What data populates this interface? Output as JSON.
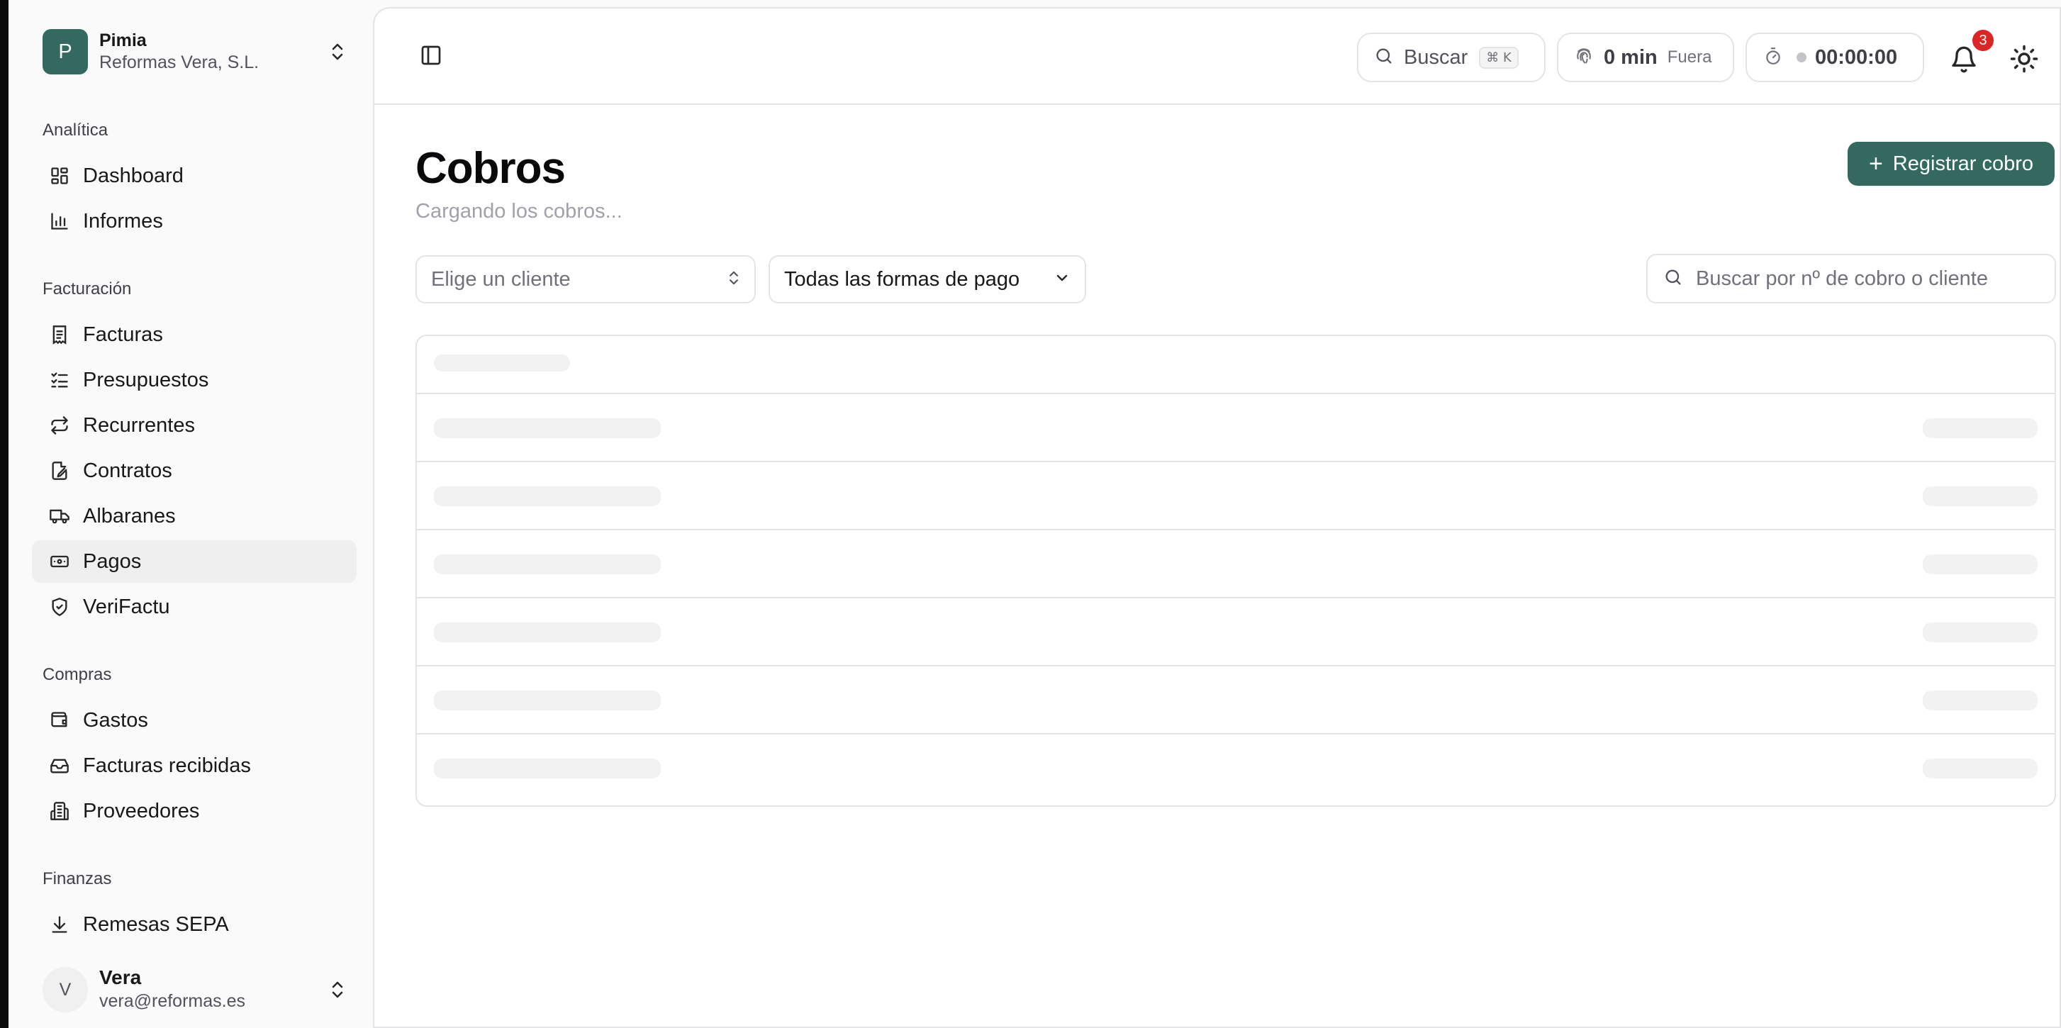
{
  "workspace": {
    "initial": "P",
    "name": "Pimia",
    "company": "Reformas Vera, S.L."
  },
  "sidebar": {
    "groups": [
      {
        "label": "Analítica"
      },
      {
        "label": "Facturación"
      },
      {
        "label": "Compras"
      },
      {
        "label": "Finanzas"
      }
    ],
    "items": [
      {
        "label": "Dashboard",
        "icon": "dashboard-icon"
      },
      {
        "label": "Informes",
        "icon": "bar-chart-icon"
      },
      {
        "label": "Facturas",
        "icon": "invoice-icon"
      },
      {
        "label": "Presupuestos",
        "icon": "checklist-icon"
      },
      {
        "label": "Recurrentes",
        "icon": "repeat-icon"
      },
      {
        "label": "Contratos",
        "icon": "file-signature-icon"
      },
      {
        "label": "Albaranes",
        "icon": "truck-icon"
      },
      {
        "label": "Pagos",
        "icon": "banknote-icon",
        "active": true
      },
      {
        "label": "VeriFactu",
        "icon": "shield-check-icon"
      },
      {
        "label": "Gastos",
        "icon": "wallet-icon"
      },
      {
        "label": "Facturas recibidas",
        "icon": "inbox-icon"
      },
      {
        "label": "Proveedores",
        "icon": "building-icon"
      },
      {
        "label": "Remesas SEPA",
        "icon": "download-icon"
      }
    ]
  },
  "user": {
    "initial": "V",
    "name": "Vera",
    "email": "vera@reformas.es"
  },
  "topbar": {
    "search_label": "Buscar",
    "search_shortcut": "⌘ K",
    "clock_value": "0 min",
    "clock_status": "Fuera",
    "timer": "00:00:00",
    "notifications": "3"
  },
  "page": {
    "title": "Cobros",
    "subtitle": "Cargando los cobros...",
    "primary_action": "Registrar cobro"
  },
  "filters": {
    "client_placeholder": "Elige un cliente",
    "payment_method": "Todas las formas de pago",
    "search_placeholder": "Buscar por nº de cobro o cliente"
  },
  "colors": {
    "brand": "#33695f",
    "badge": "#dc2626",
    "skeleton": "#f2f2f3"
  },
  "table": {
    "state": "loading",
    "skeleton_rows": 6
  }
}
